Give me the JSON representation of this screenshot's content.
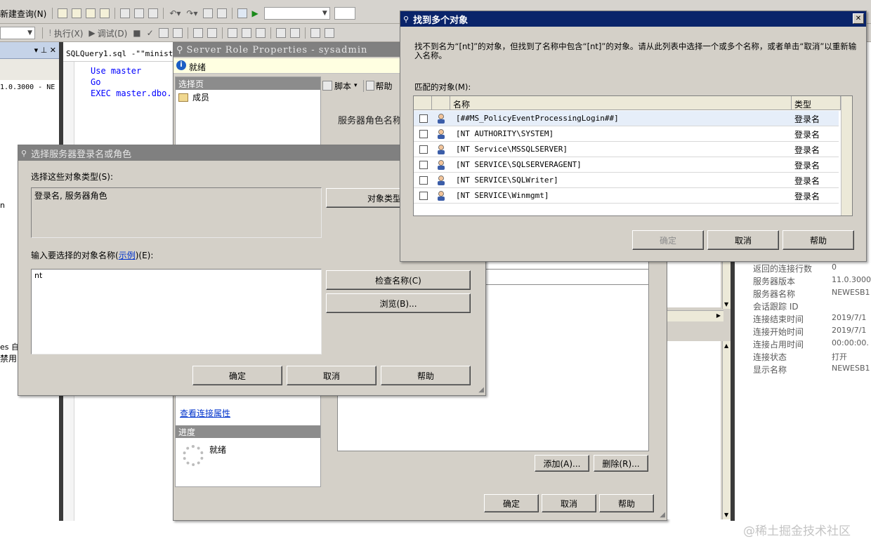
{
  "toolbar1": {
    "new_query_label": "新建查询(N)"
  },
  "toolbar2": {
    "execute_label": "执行(X)",
    "debug_label": "调试(D)"
  },
  "left_panel": {
    "pin_glyph": "▾ ⊥ ✕",
    "version_text": "1.0.3000 - NE",
    "frag_n": "n",
    "frag_es": "es 自",
    "frag_disabled": "禁用"
  },
  "query_editor": {
    "tab_title": "SQLQuery1.sql -\"\"ministr",
    "lines": [
      "Use master",
      "Go",
      "EXEC master.dbo."
    ]
  },
  "server_role_window": {
    "title": "Server Role Properties - sysadmin",
    "status": "就绪",
    "pages_header": "选择页",
    "page_members": "成员",
    "script_label": "脚本",
    "help_label": "帮助",
    "role_name_label": "服务器角色名称",
    "view_conn_props": "查看连接属性",
    "progress_header": "进度",
    "progress_status": "就绪",
    "add_button": "添加(A)...",
    "remove_button": "删除(R)...",
    "ok": "确定",
    "cancel": "取消",
    "help": "帮助"
  },
  "select_login_dialog": {
    "title": "选择服务器登录名或角色",
    "object_types_label": "选择这些对象类型(S):",
    "object_types_value": "登录名, 服务器角色",
    "object_types_button": "对象类型",
    "enter_names_label": "输入要选择的对象名称",
    "examples_link": "示例",
    "enter_names_suffix": "(E):",
    "names_value": "nt",
    "check_names_button": "检查名称(C)",
    "browse_button": "浏览(B)...",
    "ok": "确定",
    "cancel": "取消",
    "help": "帮助"
  },
  "find_multiple_dialog": {
    "title": "找到多个对象",
    "close_glyph": "✕",
    "message": "找不到名为“[nt]”的对象，但找到了名称中包含“[nt]”的对象。请从此列表中选择一个或多个名称，或者单击“取消”以重新输入名称。",
    "matching_label": "匹配的对象(M):",
    "col_name": "名称",
    "col_type": "类型",
    "rows": [
      {
        "name": "[##MS_PolicyEventProcessingLogin##]",
        "type": "登录名"
      },
      {
        "name": "[NT AUTHORITY\\SYSTEM]",
        "type": "登录名"
      },
      {
        "name": "[NT Service\\MSSQLSERVER]",
        "type": "登录名"
      },
      {
        "name": "[NT SERVICE\\SQLSERVERAGENT]",
        "type": "登录名"
      },
      {
        "name": "[NT SERVICE\\SQLWriter]",
        "type": "登录名"
      },
      {
        "name": "[NT SERVICE\\Winmgmt]",
        "type": "登录名"
      }
    ],
    "ok": "确定",
    "cancel": "取消",
    "help": "帮助"
  },
  "properties_panel": {
    "rows": [
      {
        "label": "返回的连接行数",
        "value": "0"
      },
      {
        "label": "服务器版本",
        "value": "11.0.3000"
      },
      {
        "label": "服务器名称",
        "value": "NEWESB1"
      },
      {
        "label": "会话跟踪 ID",
        "value": ""
      },
      {
        "label": "连接结束时间",
        "value": "2019/7/1"
      },
      {
        "label": "连接开始时间",
        "value": "2019/7/1"
      },
      {
        "label": "连接占用时间",
        "value": "00:00:00."
      },
      {
        "label": "连接状态",
        "value": "打开"
      },
      {
        "label": "显示名称",
        "value": "NEWESB1"
      }
    ]
  },
  "watermark": "@稀土掘金技术社区",
  "colors": {
    "active_title": "#0a246a",
    "inactive_title": "#808080",
    "dialog_face": "#d4d0c8",
    "link": "#0033cc",
    "selected_row": "#e6eef9"
  },
  "icons": [
    "new-document-icon",
    "open-icon",
    "save-icon",
    "cut-icon",
    "copy-icon",
    "paste-icon",
    "undo-icon",
    "redo-icon",
    "execute-icon",
    "info-icon",
    "search-icon",
    "user-icon",
    "close-icon",
    "resize-grip-icon",
    "spinner-icon"
  ]
}
